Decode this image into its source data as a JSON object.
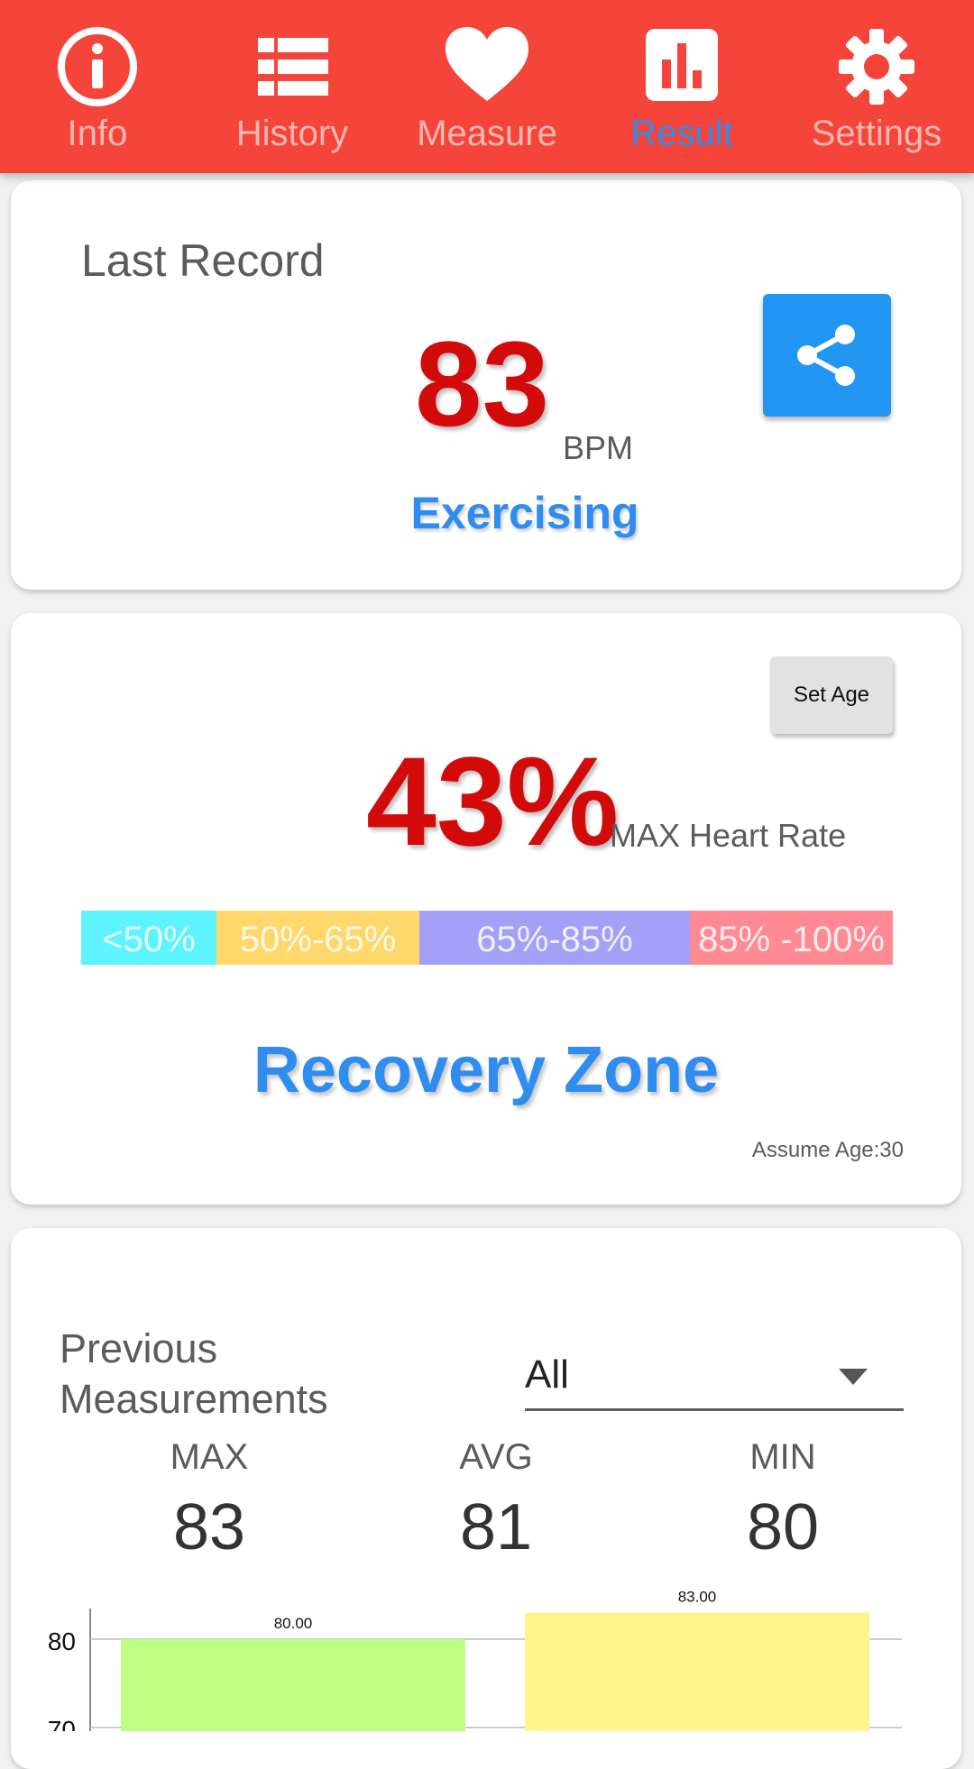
{
  "nav": {
    "tabs": [
      {
        "label": "Info",
        "icon": "info-icon",
        "active": false
      },
      {
        "label": "History",
        "icon": "list-icon",
        "active": false
      },
      {
        "label": "Measure",
        "icon": "heart-icon",
        "active": false
      },
      {
        "label": "Result",
        "icon": "bar-chart-icon",
        "active": true
      },
      {
        "label": "Settings",
        "icon": "gear-icon",
        "active": false
      }
    ]
  },
  "last_record": {
    "title": "Last Record",
    "bpm": "83",
    "unit": "BPM",
    "state": "Exercising",
    "share_icon": "share-icon"
  },
  "heart_rate": {
    "set_age_label": "Set Age",
    "percent": "43%",
    "percent_label": "MAX Heart Rate",
    "zones": [
      {
        "label": "<50%",
        "color": "#5ef4ff"
      },
      {
        "label": "50%-65%",
        "color": "#ffd76b"
      },
      {
        "label": "65%-85%",
        "color": "#a3a0f7"
      },
      {
        "label": "85% -100%",
        "color": "#ff8a94"
      }
    ],
    "zone_name": "Recovery Zone",
    "assume_age": "Assume Age:30"
  },
  "previous": {
    "title": "Previous Measurements",
    "filter_value": "All",
    "stats": [
      {
        "label": "MAX",
        "value": "83"
      },
      {
        "label": "AVG",
        "value": "81"
      },
      {
        "label": "MIN",
        "value": "80"
      }
    ]
  },
  "chart_data": {
    "type": "bar",
    "categories": [
      "",
      ""
    ],
    "values": [
      80,
      83
    ],
    "data_labels": [
      "80.00",
      "83.00"
    ],
    "colors": [
      "#bfff86",
      "#fff58c"
    ],
    "y_ticks": [
      80,
      70
    ],
    "ylim": [
      70,
      84
    ],
    "grid": true
  }
}
